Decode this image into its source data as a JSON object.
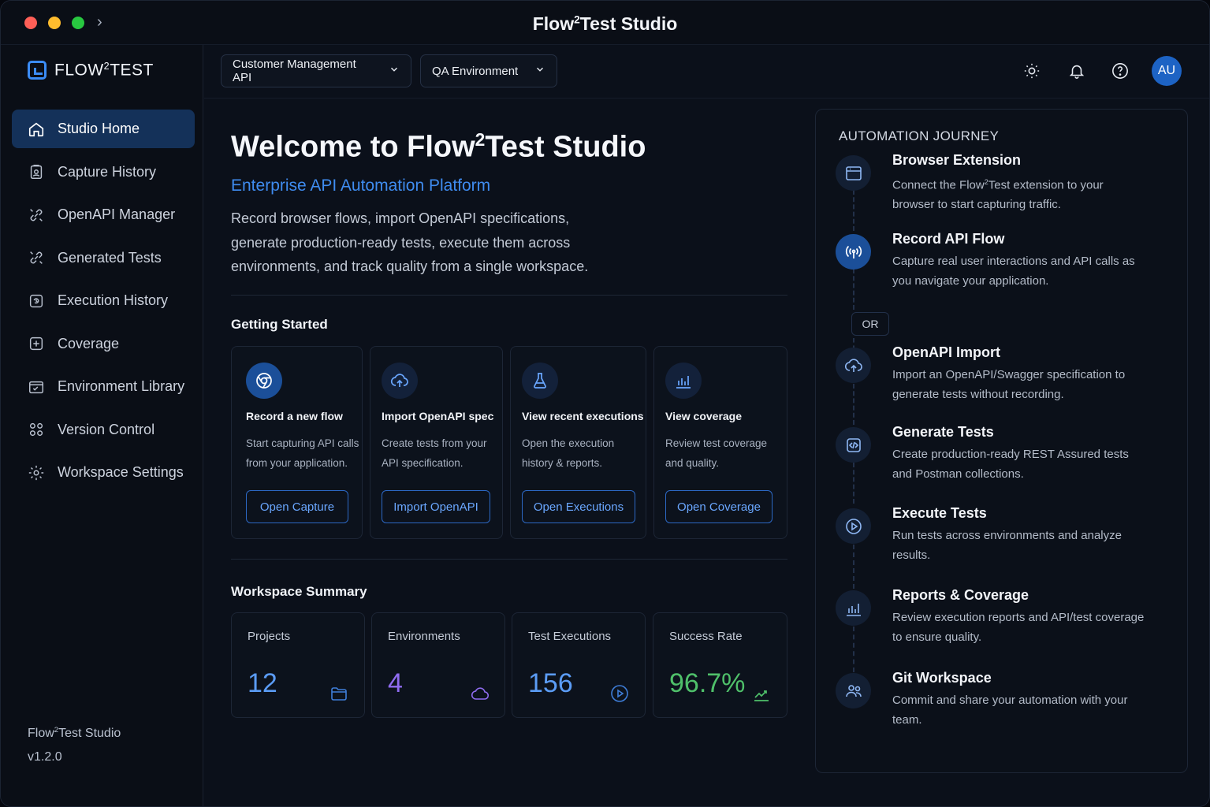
{
  "window": {
    "title_pre": "Flow",
    "title_sup": "2",
    "title_post": "Test Studio"
  },
  "brand": {
    "pre": "FLOW",
    "sup": "2",
    "post": "TEST"
  },
  "sidebar": {
    "items": [
      {
        "label": "Studio Home",
        "icon": "home-icon",
        "active": true
      },
      {
        "label": "Capture History",
        "icon": "clipboard-icon"
      },
      {
        "label": "OpenAPI Manager",
        "icon": "api-link-icon"
      },
      {
        "label": "Generated Tests",
        "icon": "api-link-icon"
      },
      {
        "label": "Execution History",
        "icon": "history-icon"
      },
      {
        "label": "Coverage",
        "icon": "coverage-icon"
      },
      {
        "label": "Environment Library",
        "icon": "environment-icon"
      },
      {
        "label": "Version Control",
        "icon": "version-control-icon"
      },
      {
        "label": "Workspace Settings",
        "icon": "gear-icon"
      }
    ],
    "footer": {
      "app_pre": "Flow",
      "app_sup": "2",
      "app_post": "Test Studio",
      "version": "v1.2.0"
    }
  },
  "header": {
    "project_select": "Customer Management API",
    "environment_select": "QA Environment",
    "avatar_initials": "AU"
  },
  "main": {
    "welcome_pre": "Welcome to Flow",
    "welcome_sup": "2",
    "welcome_post": "Test Studio",
    "subtitle": "Enterprise API Automation Platform",
    "intro": "Record browser flows, import OpenAPI specifications, generate production-ready tests, execute them across environments, and track quality from a single workspace.",
    "getting_started_title": "Getting Started",
    "getting_started": [
      {
        "title": "Record a new flow",
        "desc": "Start capturing API calls from your application.",
        "button": "Open Capture",
        "icon": "chrome-icon"
      },
      {
        "title": "Import OpenAPI spec",
        "desc": "Create tests from your API specification.",
        "button": "Import OpenAPI",
        "icon": "cloud-upload-icon"
      },
      {
        "title": "View recent executions",
        "desc": "Open the execution history & reports.",
        "button": "Open Executions",
        "icon": "flask-icon"
      },
      {
        "title": "View coverage",
        "desc": "Review test coverage and quality.",
        "button": "Open Coverage",
        "icon": "bar-chart-icon"
      }
    ],
    "summary_title": "Workspace Summary",
    "summary": [
      {
        "label": "Projects",
        "value": "12",
        "color": "#5b9cf5",
        "icon": "folder-icon"
      },
      {
        "label": "Environments",
        "value": "4",
        "color": "#8f6cf0",
        "icon": "cloud-icon"
      },
      {
        "label": "Test Executions",
        "value": "156",
        "color": "#5b9cf5",
        "icon": "play-circle-icon"
      },
      {
        "label": "Success Rate",
        "value": "96.7%",
        "color": "#4fc06a",
        "icon": "trend-up-icon"
      }
    ]
  },
  "journey": {
    "title": "AUTOMATION JOURNEY",
    "or_label": "OR",
    "steps": [
      {
        "title": "Browser Extension",
        "desc_pre": "Connect the Flow",
        "desc_sup": "2",
        "desc_post": "Test extension to your browser to start capturing traffic.",
        "icon": "browser-window-icon"
      },
      {
        "title": "Record API Flow",
        "desc": "Capture real user interactions and API calls as you navigate your application.",
        "icon": "broadcast-icon"
      },
      {
        "title": "OpenAPI Import",
        "desc": "Import an OpenAPI/Swagger specification to generate tests without recording.",
        "icon": "cloud-upload-icon"
      },
      {
        "title": "Generate Tests",
        "desc": "Create production-ready REST Assured tests and Postman collections.",
        "icon": "code-icon"
      },
      {
        "title": "Execute Tests",
        "desc": "Run tests across environments and analyze results.",
        "icon": "play-circle-icon"
      },
      {
        "title": "Reports & Coverage",
        "desc": "Review execution reports and API/test coverage to ensure quality.",
        "icon": "bar-chart-icon"
      },
      {
        "title": "Git Workspace",
        "desc": "Commit and share your automation with your team.",
        "icon": "users-icon"
      }
    ]
  },
  "colors": {
    "accent": "#3f8cf0",
    "active_nav": "#143159",
    "background": "#0b101a"
  }
}
